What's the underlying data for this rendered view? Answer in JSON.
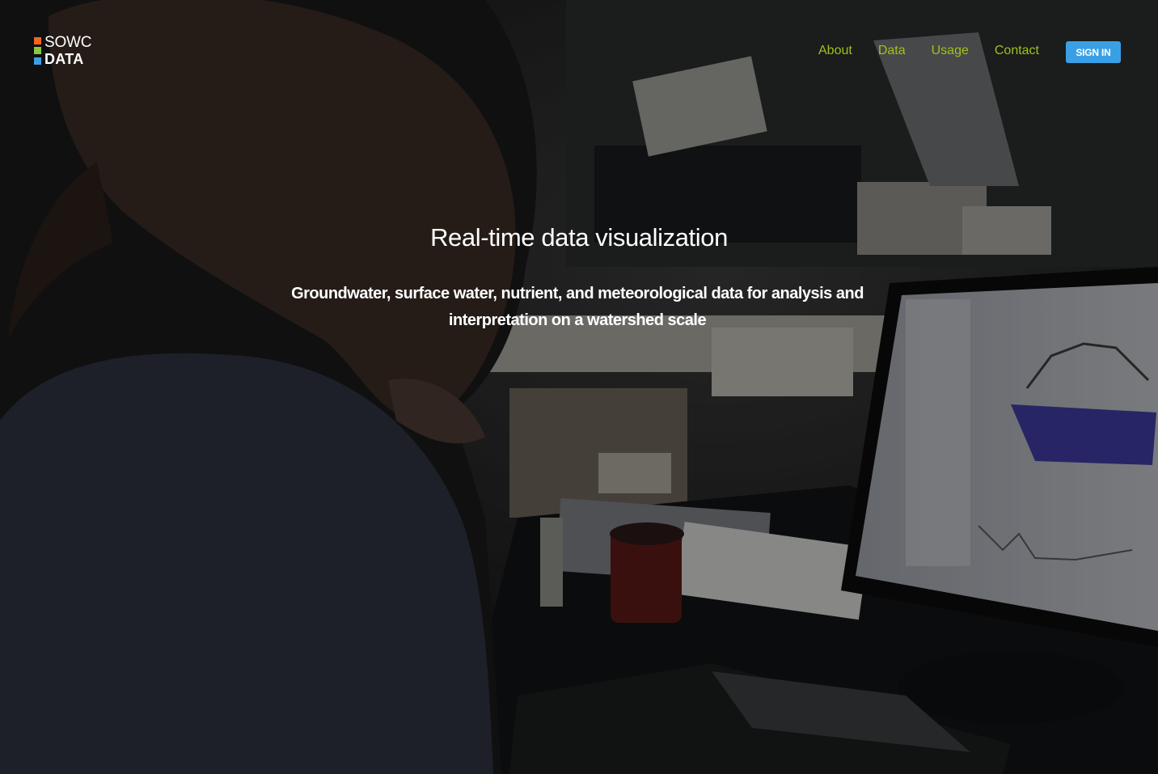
{
  "brand": {
    "line1": "SOWC",
    "line2": "DATA",
    "colors": {
      "orange": "#f26522",
      "green": "#8dc63f",
      "blue": "#3aa0e6"
    }
  },
  "nav": {
    "items": [
      {
        "label": "About"
      },
      {
        "label": "Data"
      },
      {
        "label": "Usage"
      },
      {
        "label": "Contact"
      }
    ],
    "signin_label": "SIGN IN",
    "link_color": "#9dc21f",
    "button_color": "#3aa0e6"
  },
  "hero": {
    "title": "Real-time data visualization",
    "subtitle": "Groundwater, surface water, nutrient, and meteorological data for analysis and interpretation on a watershed scale",
    "background": "lab-researcher-at-computer-photo"
  }
}
